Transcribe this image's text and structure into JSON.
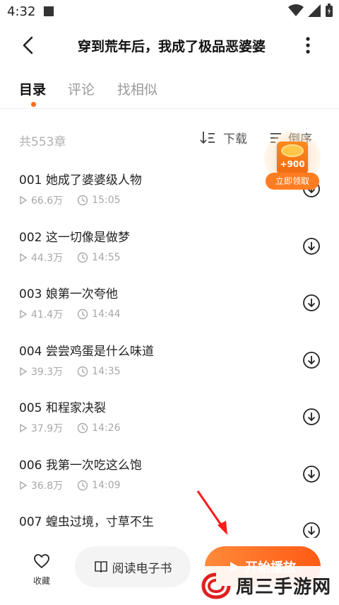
{
  "status_bar": {
    "time": "4:32"
  },
  "header": {
    "title": "穿到荒年后，我成了极品恶婆婆"
  },
  "tabs": [
    {
      "label": "目录",
      "active": true
    },
    {
      "label": "评论",
      "active": false
    },
    {
      "label": "找相似",
      "active": false
    }
  ],
  "toolbar": {
    "chapter_count": "共553章",
    "download_label": "下载",
    "sort_label": "倒序"
  },
  "reward": {
    "amount": "+900",
    "label": "立即领取"
  },
  "chapters": [
    {
      "title": "001 她成了婆婆级人物",
      "plays": "66.6万",
      "duration": "15:05"
    },
    {
      "title": "002 这一切像是做梦",
      "plays": "44.3万",
      "duration": "14:55"
    },
    {
      "title": "003 娘第一次夸他",
      "plays": "41.4万",
      "duration": "14:44"
    },
    {
      "title": "004 尝尝鸡蛋是什么味道",
      "plays": "39.3万",
      "duration": "14:35"
    },
    {
      "title": "005 和程家决裂",
      "plays": "37.9万",
      "duration": "14:26"
    },
    {
      "title": "006 我第一次吃这么饱",
      "plays": "36.8万",
      "duration": "14:09"
    },
    {
      "title": "007 蝗虫过境，寸草不生",
      "plays": "",
      "duration": ""
    }
  ],
  "bottom_bar": {
    "favorite_label": "收藏",
    "ebook_label": "阅读电子书",
    "play_label": "开始播放"
  },
  "watermark": {
    "text": "周三手游网"
  },
  "colors": {
    "accent": "#ff6a1a",
    "play_gradient_start": "#ff8a3a",
    "play_gradient_end": "#ff5a14"
  },
  "icons": [
    "back-arrow-icon",
    "more-vertical-icon",
    "download-list-icon",
    "sort-icon",
    "play-count-icon",
    "clock-icon",
    "download-circle-icon",
    "heart-icon",
    "book-icon",
    "play-icon"
  ]
}
